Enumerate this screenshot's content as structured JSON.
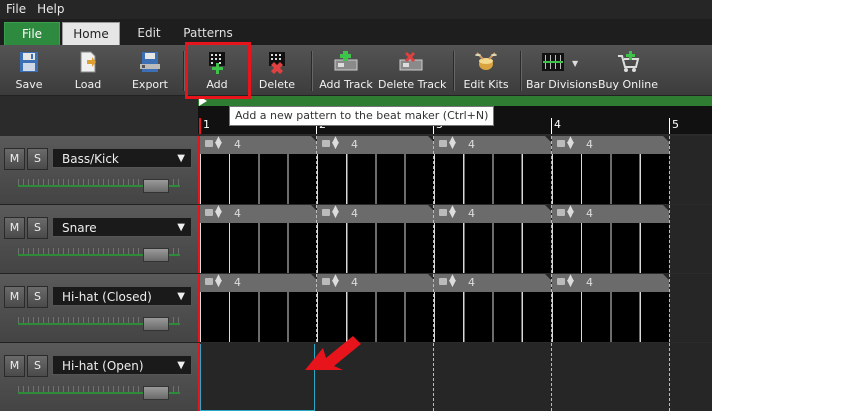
{
  "menu": {
    "file": "File",
    "help": "Help"
  },
  "tabs": [
    "File",
    "Home",
    "Edit",
    "Patterns"
  ],
  "ribbon": {
    "save": "Save",
    "load": "Load",
    "export": "Export",
    "add": "Add",
    "delete": "Delete",
    "add_track": "Add Track",
    "delete_track": "Delete Track",
    "edit_kits": "Edit Kits",
    "bar_divisions": "Bar Divisions",
    "buy_online": "Buy Online"
  },
  "tooltip": "Add a new pattern to the beat maker (Ctrl+N)",
  "timeline": {
    "bars": [
      "1",
      "2",
      "3",
      "4",
      "5"
    ]
  },
  "tracks": [
    {
      "mute": "M",
      "solo": "S",
      "name": "Bass/Kick",
      "volume": 0.85
    },
    {
      "mute": "M",
      "solo": "S",
      "name": "Snare",
      "volume": 0.85
    },
    {
      "mute": "M",
      "solo": "S",
      "name": "Hi-hat (Closed)",
      "volume": 0.85
    },
    {
      "mute": "M",
      "solo": "S",
      "name": "Hi-hat (Open)",
      "volume": 0.85
    }
  ],
  "pattern_beats": "4",
  "colors": {
    "accent": "#2e7d32",
    "highlight": "#e8141b",
    "selection": "#2aa8c7"
  },
  "icons": {
    "dropdown": "chevron-down-icon",
    "lock": "lock-icon",
    "sort": "sort-arrows-icon"
  }
}
